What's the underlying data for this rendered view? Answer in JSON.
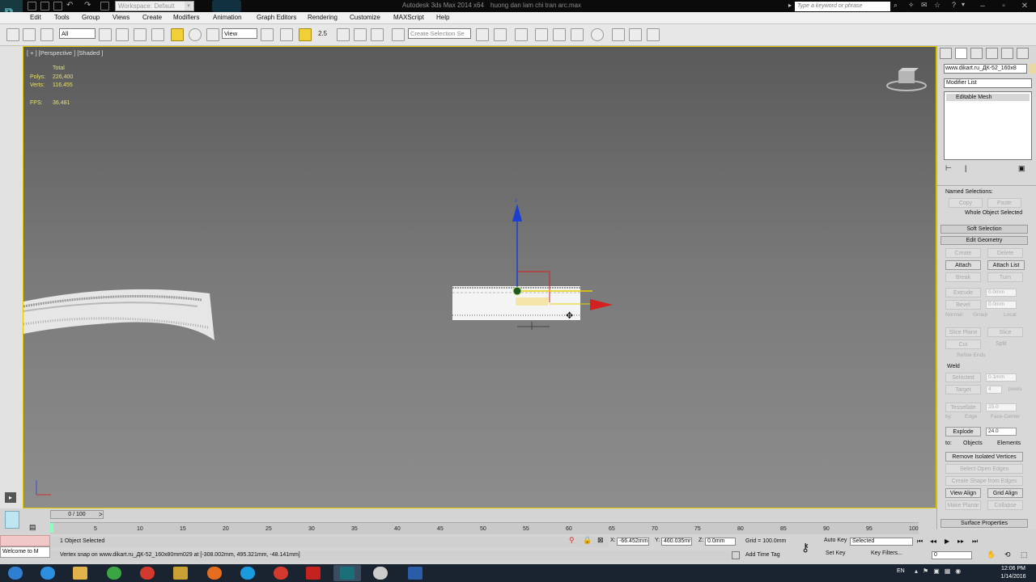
{
  "app": {
    "title": "Autodesk 3ds Max 2014 x64",
    "file_title": "huong dan lam chi tran arc.max",
    "workspace_label": "Workspace: Default",
    "search_placeholder": "Type a keyword or phrase"
  },
  "menu": [
    "Edit",
    "Tools",
    "Group",
    "Views",
    "Create",
    "Modifiers",
    "Animation",
    "Graph Editors",
    "Rendering",
    "Customize",
    "MAXScript",
    "Help"
  ],
  "toolbar": {
    "filter_value": "All",
    "reference_coord": "View",
    "named_selection_placeholder": "Create Selection Se",
    "snap_label": "2.5"
  },
  "viewport": {
    "label": "[ + ] [Perspective ] [Shaded ]",
    "stats": {
      "total_label": "Total",
      "polys_label": "Polys:",
      "polys_value": "226,400",
      "verts_label": "Verts:",
      "verts_value": "116,455",
      "fps_label": "FPS:",
      "fps_value": "36.481"
    }
  },
  "command_panel": {
    "object_name": "www.dikart.ru_ДК-52_160x8",
    "modifier_list_label": "Modifier List",
    "stack_item": "Editable Mesh",
    "named_selections_label": "Named Selections:",
    "copy_label": "Copy",
    "paste_label": "Paste",
    "selection_status": "Whole Object Selected",
    "soft_selection_label": "Soft Selection",
    "edit_geometry_label": "Edit Geometry",
    "create_label": "Create",
    "delete_label": "Delete",
    "attach_label": "Attach",
    "attach_list_label": "Attach List",
    "break_label": "Break",
    "turn_label": "Turn",
    "extrude_label": "Extrude",
    "extrude_value": "0.0mm",
    "bevel_label": "Bevel",
    "bevel_value": "0.0mm",
    "normal_label": "Normal:",
    "group_label": "Group",
    "local_label": "Local",
    "slice_plane_label": "Slice Plane",
    "slice_label": "Slice",
    "cut_label": "Cut",
    "split_label": "Split",
    "refine_ends_label": "Refine Ends",
    "weld_label": "Weld",
    "selected_label": "Selected",
    "selected_value": "0.1mm",
    "target_label": "Target",
    "target_value": "4",
    "pixels_label": "pixels",
    "tessellate_label": "Tessellate",
    "tessellate_value": "25.0",
    "by_label": "by:",
    "edge_label": "Edge",
    "face_center_label": "Face-Center",
    "explode_label": "Explode",
    "explode_value": "24.0",
    "to_label": "to:",
    "objects_label": "Objects",
    "elements_label": "Elements",
    "remove_isolated_label": "Remove Isolated Vertices",
    "select_open_edges_label": "Select Open Edges",
    "create_shape_label": "Create Shape from Edges",
    "view_align_label": "View Align",
    "grid_align_label": "Grid Align",
    "make_planar_label": "Make Planar",
    "collapse_label": "Collapse",
    "surface_properties_label": "Surface Properties"
  },
  "timeline": {
    "frame_counter": "0 / 100",
    "ticks": [
      "5",
      "10",
      "15",
      "20",
      "25",
      "30",
      "35",
      "40",
      "45",
      "50",
      "55",
      "60",
      "65",
      "70",
      "75",
      "80",
      "85",
      "90",
      "95",
      "100"
    ]
  },
  "status": {
    "selection": "1 Object Selected",
    "prompt": "Vertex snap on www.dikart.ru_ДК-52_160x80mm029 at [-308.002mm, 495.321mm, -48.141mm]",
    "listener": "Welcome to M",
    "x_label": "X:",
    "x_value": "-66.452mm",
    "y_label": "Y:",
    "y_value": "460.035mr",
    "z_label": "Z:",
    "z_value": "0.0mm",
    "grid": "Grid = 100.0mm",
    "add_time_tag": "Add Time Tag",
    "auto_key": "Auto Key",
    "set_key": "Set Key",
    "key_mode": "Selected",
    "key_filters": "Key Filters...",
    "frame_field": "0"
  },
  "taskbar": {
    "language": "EN",
    "time": "12:06 PM",
    "date": "1/14/2016"
  },
  "colors": {
    "viewport_border": "#e3c800",
    "active_tool": "#f1cf39",
    "gizmo_x": "#d42020",
    "gizmo_z": "#1a3fd1"
  }
}
